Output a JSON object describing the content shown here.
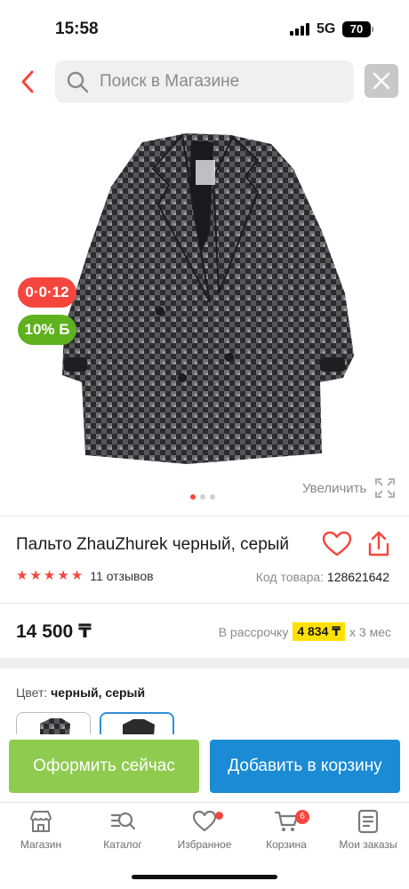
{
  "status_bar": {
    "time": "15:58",
    "network": "5G",
    "battery": "70"
  },
  "search": {
    "placeholder": "Поиск в Магазине"
  },
  "gallery": {
    "timer_badge": "0·0·12",
    "cashback_badge": "10% Б",
    "zoom_label": "Увеличить",
    "image_count": 3,
    "active_image": 0
  },
  "product": {
    "title": "Пальто ZhauZhurek черный, серый",
    "rating": 5,
    "reviews": "11 отзывов",
    "sku_label": "Код товара:",
    "sku": "128621642",
    "price": "14 500 ₸",
    "installment_prefix": "В рассрочку",
    "installment_amount": "4 834 ₸",
    "installment_suffix": "x 3 мес",
    "color_label": "Цвет:",
    "color_value": "черный, серый"
  },
  "actions": {
    "buy_now": "Оформить сейчас",
    "add_to_cart": "Добавить в корзину"
  },
  "nav": {
    "items": [
      {
        "label": "Магазин",
        "icon": "store-icon"
      },
      {
        "label": "Каталог",
        "icon": "catalog-search-icon"
      },
      {
        "label": "Избранное",
        "icon": "heart-icon"
      },
      {
        "label": "Корзина",
        "icon": "cart-icon",
        "badge": "6"
      },
      {
        "label": "Мои заказы",
        "icon": "orders-icon"
      }
    ]
  },
  "colors": {
    "accent": "#f5463e",
    "buy_button": "#8fcb4f",
    "cart_button": "#1a8bd4",
    "cashback": "#5fb11d",
    "installment_highlight": "#ffe100"
  }
}
